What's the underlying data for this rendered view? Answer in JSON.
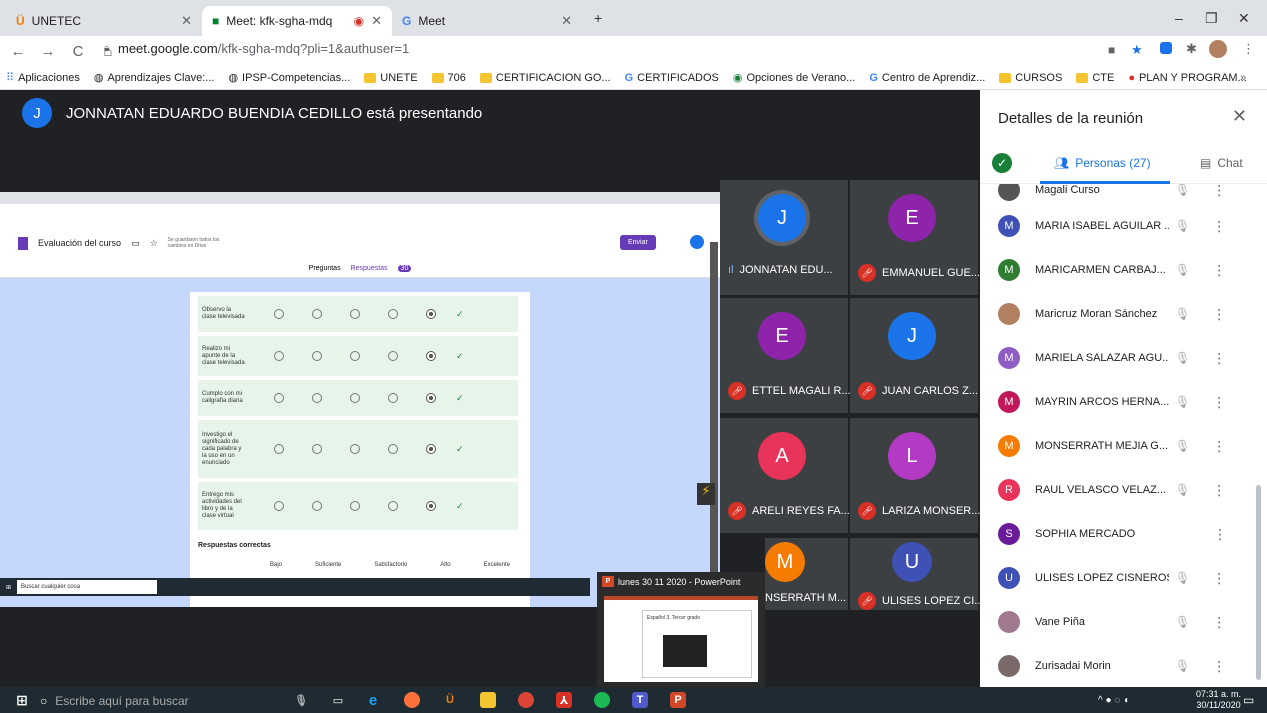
{
  "browser": {
    "tabs": [
      {
        "label": "UNETEC"
      },
      {
        "label": "Meet: kfk-sgha-mdq"
      },
      {
        "label": "Meet"
      }
    ],
    "url_host": "meet.google.com",
    "url_path": "/kfk-sgha-mdq?pli=1&authuser=1",
    "bookmarks": [
      "Aplicaciones",
      "Aprendizajes Clave:...",
      "IPSP-Competencias...",
      "UNETE",
      "706",
      "CERTIFICACION GO...",
      "CERTIFICADOS",
      "Opciones de Verano...",
      "Centro de Aprendiz...",
      "CURSOS",
      "CTE",
      "PLAN Y PROGRAM..."
    ]
  },
  "meet": {
    "presenter_initial": "J",
    "presenter_text": "JONNATAN EDUARDO BUENDIA CEDILLO está presentando",
    "tiles": [
      {
        "initial": "J",
        "name": "JONNATAN EDU...",
        "color": "#1a73e8",
        "speaking": true
      },
      {
        "initial": "E",
        "name": "EMMANUEL GUE...",
        "color": "#8e24aa"
      },
      {
        "initial": "E",
        "name": "ETTEL MAGALI R...",
        "color": "#8e24aa"
      },
      {
        "initial": "J",
        "name": "JUAN CARLOS Z...",
        "color": "#1a73e8"
      },
      {
        "initial": "A",
        "name": "ARELI REYES FA...",
        "color": "#e8335a"
      },
      {
        "initial": "L",
        "name": "LARIZA MONSER...",
        "color": "#b33ac2"
      },
      {
        "initial": "M",
        "name": "NSERRATH M...",
        "color": "#f57c00"
      },
      {
        "initial": "U",
        "name": "ULISES LOPEZ CI...",
        "color": "#3f51b5"
      }
    ]
  },
  "shared": {
    "form_title": "Evaluación del curso",
    "saved_text": "Se guardaron todos los cambios en Drive",
    "send_label": "Enviar",
    "tab_questions": "Preguntas",
    "tab_answers": "Respuestas",
    "answers_count": "30",
    "rows": [
      {
        "label": "Observo la clase televisada"
      },
      {
        "label": "Realizo mi apunte de la clase televisada"
      },
      {
        "label": "Cumplo con mi caligrafía diaria"
      },
      {
        "label": "Investigo el significado de cada palabra y la uso en un enunciado"
      },
      {
        "label": "Entrego mis actividades del libro y de la clase virtual"
      }
    ],
    "correct_answers": "Respuestas correctas",
    "scale": [
      "Bajo",
      "Suficiente",
      "Satisfactorio",
      "Alto",
      "Excelente"
    ],
    "inner_search": "Buscar cualquier cosa",
    "powerpoint_title": "lunes 30 11 2020 - PowerPoint",
    "powerpoint_slide": "Español 3. Tercer grado"
  },
  "panel": {
    "title": "Detalles de la reunión",
    "people_tab": "Personas (27)",
    "chat_tab": "Chat",
    "partial_name": "Magali Curso",
    "people": [
      {
        "initial": "M",
        "name": "MARIA ISABEL AGUILAR ...",
        "color": "#3f51b5"
      },
      {
        "initial": "M",
        "name": "MARICARMEN CARBAJ...",
        "color": "#2e7d32"
      },
      {
        "initial": "",
        "name": "Maricruz Moran Sánchez",
        "color": "#b08060"
      },
      {
        "initial": "M",
        "name": "MARIELA SALAZAR AGU...",
        "color": "#8e5cc2"
      },
      {
        "initial": "M",
        "name": "MAYRIN ARCOS HERNA...",
        "color": "#c2185b"
      },
      {
        "initial": "M",
        "name": "MONSERRATH MEJIA G...",
        "color": "#f57c00"
      },
      {
        "initial": "R",
        "name": "RAUL VELASCO VELAZ...",
        "color": "#e8335a"
      },
      {
        "initial": "S",
        "name": "SOPHIA MERCADO",
        "color": "#6a1b9a"
      },
      {
        "initial": "U",
        "name": "ULISES LOPEZ CISNEROS",
        "color": "#3f51b5"
      },
      {
        "initial": "",
        "name": "Vane Piña",
        "color": "#a07890"
      },
      {
        "initial": "",
        "name": "Zurisadai Morin",
        "color": "#7a6a6a"
      }
    ]
  },
  "taskbar": {
    "search": "Escribe aquí para buscar",
    "time": "07:31 a. m.",
    "date": "30/11/2020"
  }
}
